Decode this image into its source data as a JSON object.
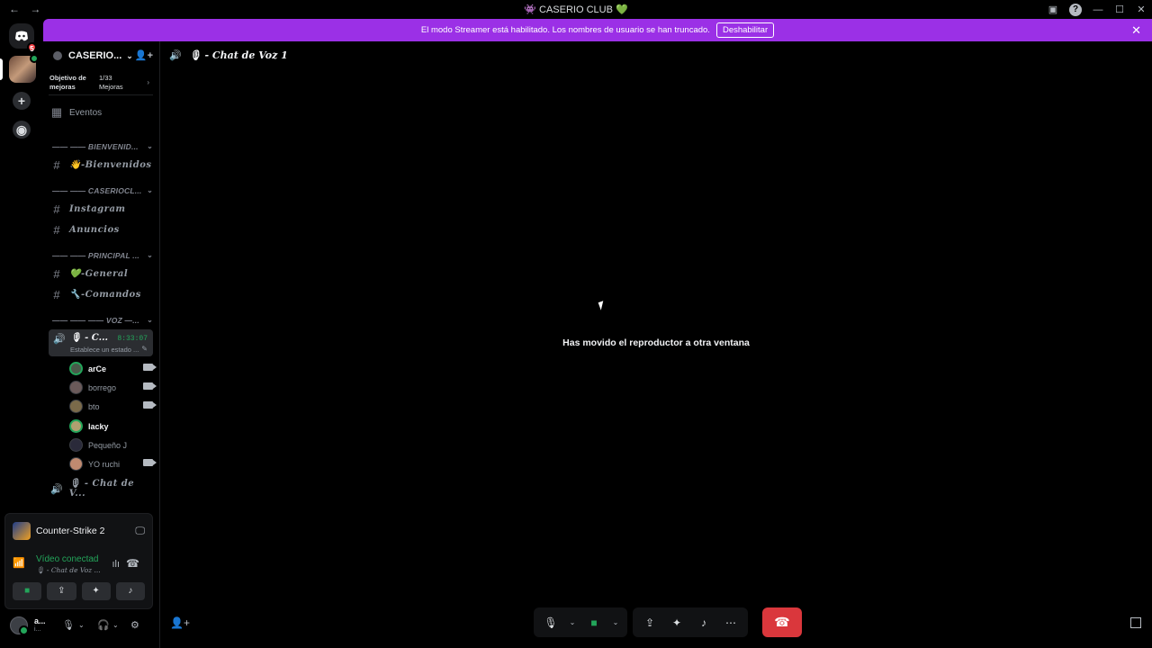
{
  "window": {
    "title": "CASERIO CLUB",
    "nav_back": "←",
    "nav_forward": "→",
    "help": "?"
  },
  "banner": {
    "message": "El modo Streamer está habilitado. Los nombres de usuario se han truncado.",
    "button": "Deshabilitar",
    "close": "✕"
  },
  "guilds": {
    "home_badge": "5"
  },
  "server": {
    "name": "CASERIO...",
    "boost_goal": "Objetivo de mejoras",
    "boost_count": "1/33 Mejoras",
    "events": "Eventos"
  },
  "categories": [
    "—— —— BIENVENID...",
    "—— —— CASERIOCL...",
    "—— —— PRINCIPAL ...",
    "—— —— —— VOZ —..."
  ],
  "channels": {
    "bienvenidos": "👋-Bienvenidos",
    "instagram": "Instagram",
    "anuncios": "Anuncios",
    "general": "💚-General",
    "comandos": "🔧-Comandos"
  },
  "voice_channel": {
    "name": "🎙 - C...",
    "timer": "8:33:07",
    "status": "Establece un estado ...",
    "second": "🎙 - Chat de V..."
  },
  "voice_users": [
    {
      "name": "arCe"
    },
    {
      "name": "borrego"
    },
    {
      "name": "bto"
    },
    {
      "name": "lacky"
    },
    {
      "name": "Pequeño J"
    },
    {
      "name": "YO ruchi"
    }
  ],
  "activity": {
    "game": "Counter-Strike 2",
    "voice_status": "Vídeo conectad",
    "voice_channel": "🎙 - Chat de Voz ..."
  },
  "user_panel": {
    "name": "a...",
    "sub": "i..."
  },
  "main": {
    "channel_title": "🎙 - Chat de Voz 1",
    "popout_message": "Has movido el reproductor a otra ventana"
  },
  "colors": {
    "accent_banner": "#9b30e6",
    "online_green": "#23a55a",
    "end_call_red": "#da373c"
  }
}
